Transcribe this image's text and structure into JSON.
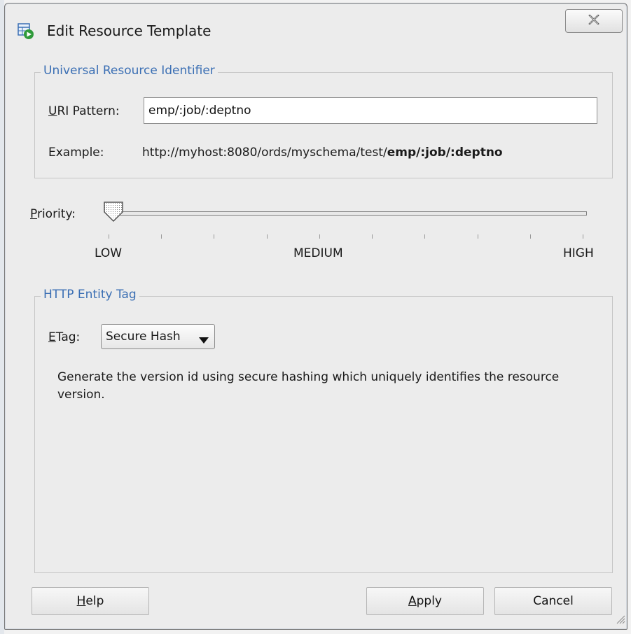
{
  "window": {
    "title": "Edit Resource Template"
  },
  "uri_group": {
    "title": "Universal Resource Identifier",
    "uri_label_mnemonic": "U",
    "uri_label_rest": "RI Pattern:",
    "uri_value": "emp/:job/:deptno",
    "example_label": "Example:",
    "example_prefix": "http://myhost:8080/ords/myschema/test/",
    "example_bold": "emp/:job/:deptno"
  },
  "priority": {
    "label_mnemonic": "P",
    "label_rest": "riority:",
    "value_level": 0,
    "tick_count": 10,
    "labels": {
      "low": "LOW",
      "medium": "MEDIUM",
      "high": "HIGH"
    }
  },
  "etag_group": {
    "title": "HTTP Entity Tag",
    "label_mnemonic": "E",
    "label_rest": "Tag:",
    "selected": "Secure Hash",
    "description": "Generate the version id using secure hashing which uniquely identifies the resource version."
  },
  "buttons": {
    "help_mnemonic": "H",
    "help_rest": "elp",
    "apply_mnemonic": "A",
    "apply_rest": "pply",
    "cancel": "Cancel"
  },
  "icons": {
    "title": "resource-template-icon",
    "close": "close-icon",
    "dropdown": "chevron-down-icon",
    "resize": "resize-grip-icon",
    "slider": "slider-thumb-icon"
  }
}
